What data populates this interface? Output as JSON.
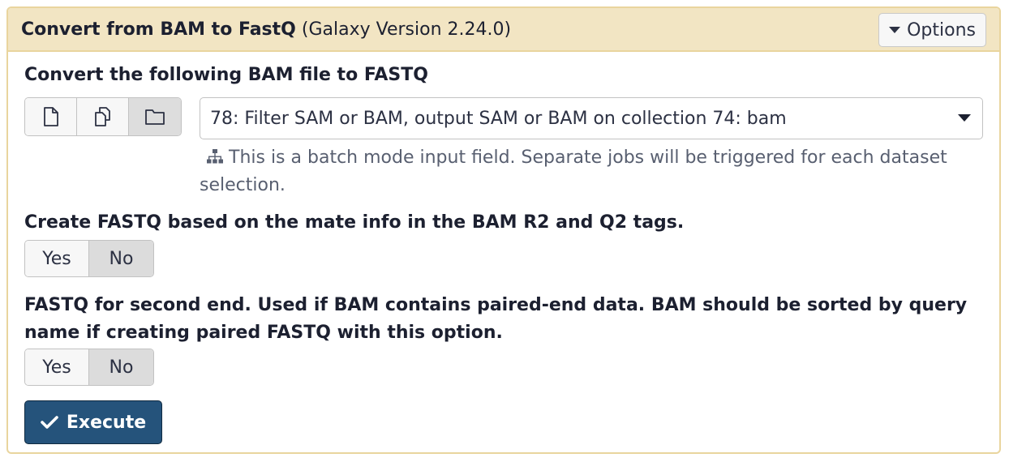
{
  "header": {
    "tool_name": "Convert from BAM to FastQ",
    "version": "(Galaxy Version 2.24.0)",
    "options_label": "Options"
  },
  "input": {
    "label": "Convert the following BAM file to FASTQ",
    "selected": "78: Filter SAM or BAM, output SAM or BAM on collection 74: bam",
    "help": "This is a batch mode input field. Separate jobs will be triggered for each dataset selection.",
    "modes": [
      "single-dataset-icon",
      "multiple-datasets-icon",
      "dataset-collection-icon"
    ],
    "active_mode": "dataset-collection-icon"
  },
  "mate_info": {
    "label": "Create FASTQ based on the mate info in the BAM R2 and Q2 tags.",
    "yes": "Yes",
    "no": "No",
    "selected": "No"
  },
  "second_end": {
    "label": "FASTQ for second end. Used if BAM contains paired-end data. BAM should be sorted by query name if creating paired FASTQ with this option.",
    "yes": "Yes",
    "no": "No",
    "selected": "No"
  },
  "execute_label": "Execute",
  "colors": {
    "header_bg": "#f2e5c3",
    "border": "#e9d59e",
    "execute_bg": "#25537b"
  }
}
